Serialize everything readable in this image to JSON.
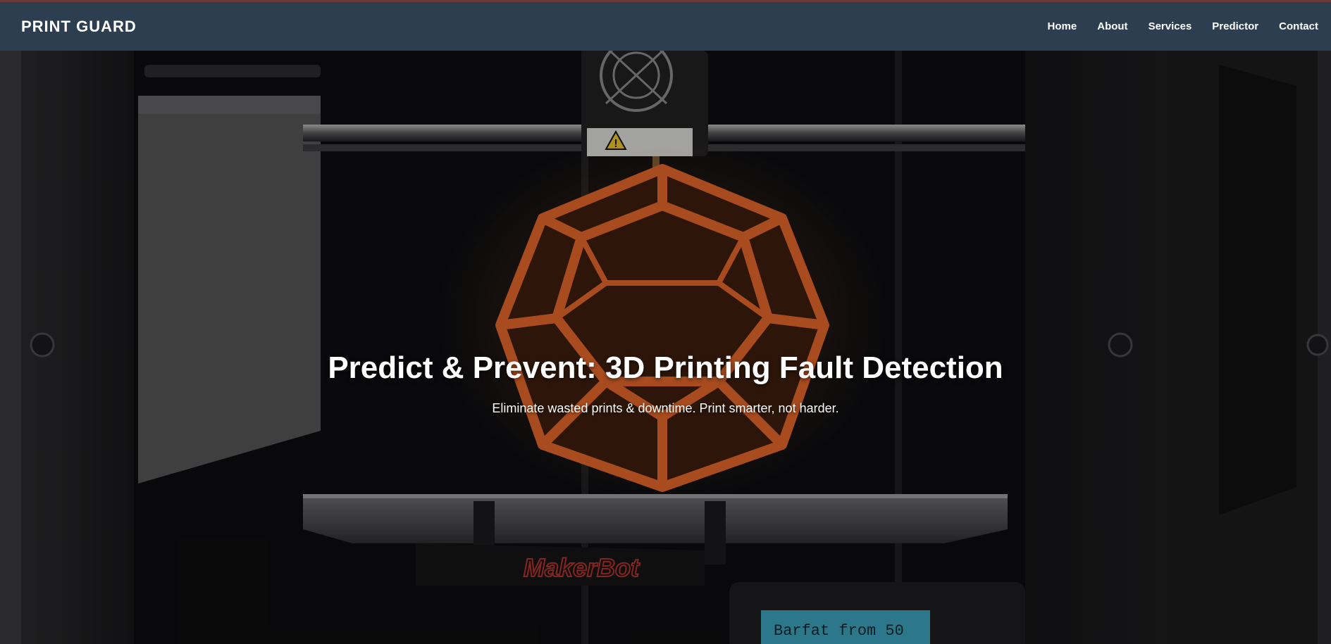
{
  "header": {
    "brand": "PRINT GUARD",
    "nav": [
      {
        "label": "Home"
      },
      {
        "label": "About"
      },
      {
        "label": "Services"
      },
      {
        "label": "Predictor"
      },
      {
        "label": "Contact"
      }
    ]
  },
  "hero": {
    "title": "Predict & Prevent: 3D Printing Fault Detection",
    "subtitle": "Eliminate wasted prints & downtime. Print smarter, not harder.",
    "image_brand_text": "MakerBot",
    "image_screen_text": "Barfat from 50"
  },
  "colors": {
    "navbar": "#2c3e50",
    "accent_line": "#6b3a3a",
    "print_orange": "#e0642a"
  },
  "icons": [
    "warning-icon",
    "fan-icon"
  ]
}
